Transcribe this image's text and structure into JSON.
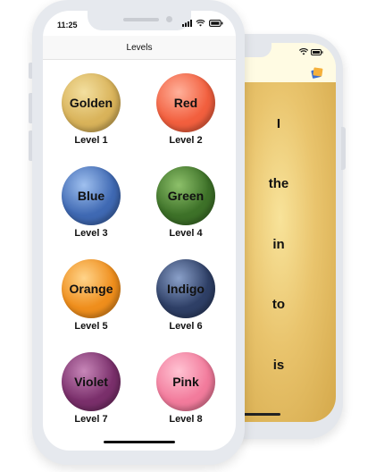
{
  "front": {
    "status_time": "11:25",
    "nav_title": "Levels",
    "levels": [
      {
        "name": "Golden",
        "label": "Level 1",
        "color": "#d9b35a",
        "highlight": "#f3df9f"
      },
      {
        "name": "Red",
        "label": "Level 2",
        "color": "#f25f3e",
        "highlight": "#ffb09a"
      },
      {
        "name": "Blue",
        "label": "Level 3",
        "color": "#3f69b3",
        "highlight": "#9fc0ef"
      },
      {
        "name": "Green",
        "label": "Level 4",
        "color": "#3d7128",
        "highlight": "#8dc06a"
      },
      {
        "name": "Orange",
        "label": "Level 5",
        "color": "#ef8e1c",
        "highlight": "#ffd48a"
      },
      {
        "name": "Indigo",
        "label": "Level 6",
        "color": "#2e3f66",
        "highlight": "#8aa0c9"
      },
      {
        "name": "Violet",
        "label": "Level 7",
        "color": "#7a2f6b",
        "highlight": "#c786b8"
      },
      {
        "name": "Pink",
        "label": "Level 8",
        "color": "#f27b9c",
        "highlight": "#ffc3d3"
      }
    ]
  },
  "back": {
    "words": [
      "I",
      "the",
      "in",
      "to",
      "is"
    ],
    "panel_color": "#e9c46d",
    "background_color": "#fffbe3"
  },
  "icons": [
    "wifi-icon",
    "battery-icon",
    "signal-icon",
    "app-icon"
  ]
}
